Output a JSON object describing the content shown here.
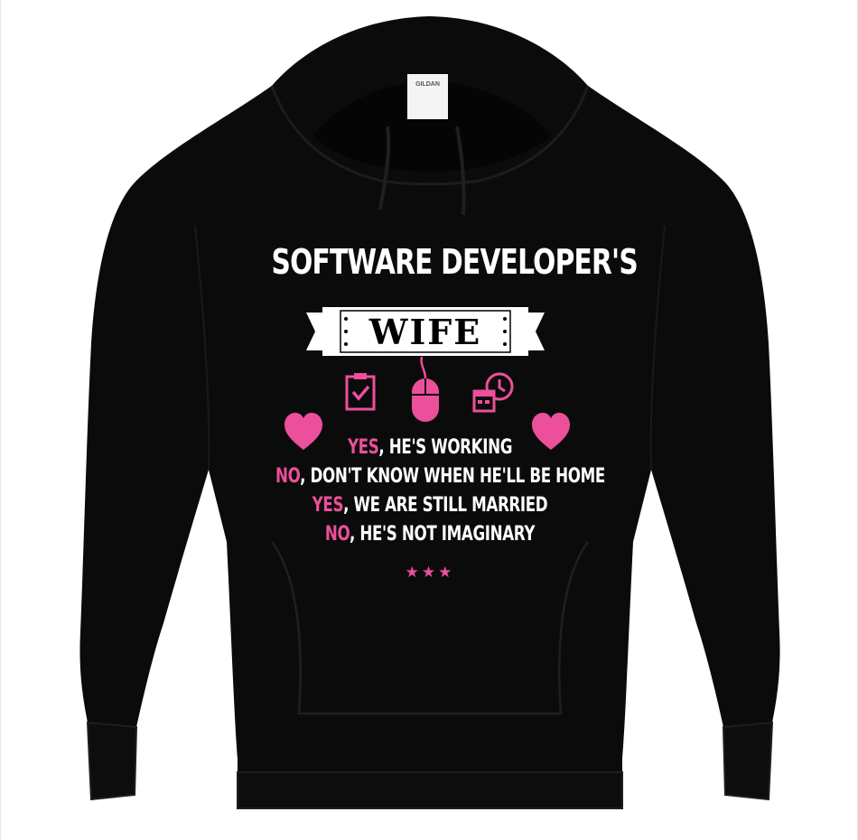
{
  "image": {
    "subject": "black hooded sweatshirt product photo",
    "colors": {
      "garment": "#0b0b0c",
      "accent": "#ec4f9b",
      "text": "#ffffff",
      "banner": "#ffffff",
      "background": "#ffffff"
    }
  },
  "tag": {
    "brand_text": "GILDAN"
  },
  "print": {
    "headline": "SOFTWARE DEVELOPER'S",
    "banner_word": "WIFE",
    "icons": [
      "clipboard-check-icon",
      "computer-mouse-icon",
      "calendar-clock-icon",
      "heart-icon",
      "heart-icon"
    ],
    "lines": [
      {
        "keyword": "YES",
        "rest": ", HE'S WORKING"
      },
      {
        "keyword": "NO",
        "rest": ", DON'T KNOW WHEN HE'LL BE HOME"
      },
      {
        "keyword": "YES",
        "rest": ", WE ARE STILL MARRIED"
      },
      {
        "keyword": "NO",
        "rest": ", HE'S NOT IMAGINARY"
      }
    ],
    "stars": "★★★"
  }
}
